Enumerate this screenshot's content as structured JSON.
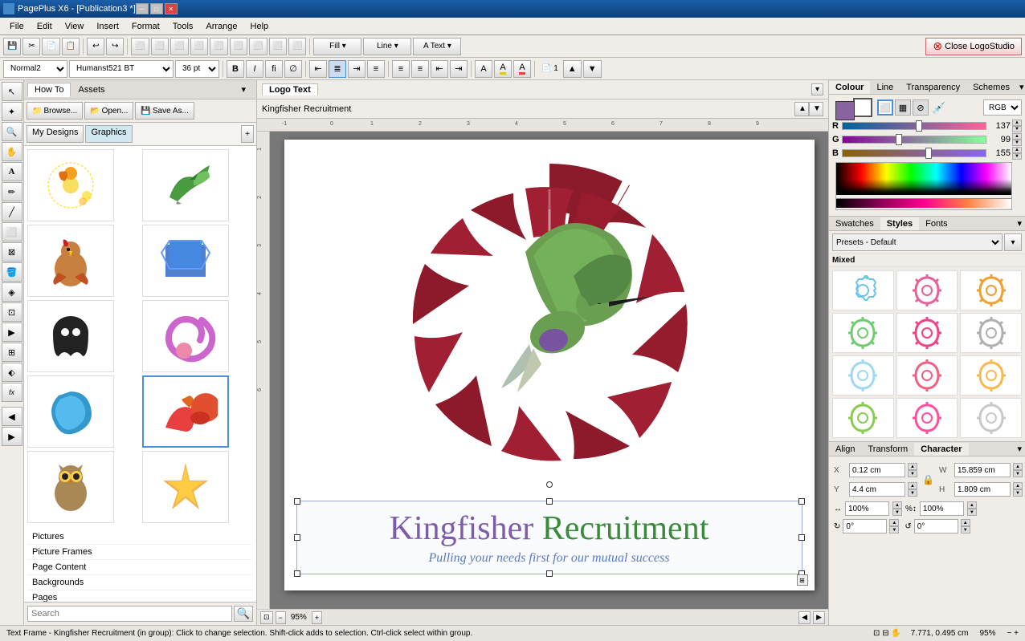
{
  "titleBar": {
    "title": "PagePlus X6 - [Publication3 *]",
    "minimize": "─",
    "maximize": "□",
    "close": "✕"
  },
  "menuBar": {
    "items": [
      "File",
      "Edit",
      "View",
      "Insert",
      "Format",
      "Tools",
      "Arrange",
      "Help"
    ]
  },
  "toolbar1": {
    "buttons": [
      "💾",
      "✂",
      "📋",
      "📋",
      "↩",
      "↪",
      "⬜",
      "⬜",
      "⬜",
      "⬜",
      "⬜",
      "⬜"
    ],
    "fillLabel": "Fill ▾",
    "lineLabel": "Line ▾",
    "textLabel": "A Text ▾",
    "closeLogoStudio": "Close LogoStudio"
  },
  "toolbar2": {
    "fontStyle": "Normal2",
    "fontName": "Humanst521 BT",
    "fontSize": "36 pt",
    "bold": "B",
    "italic": "I",
    "other": "fi",
    "other2": "∅",
    "alignLeft": "≡",
    "alignCenter": "≡",
    "alignRight": "≡",
    "justify": "≡",
    "listBullet": "≡",
    "listNum": "≡",
    "indent1": "⇤",
    "indent2": "⇥",
    "charBtn": "A",
    "highlightBtn": "A",
    "page": "1"
  },
  "assetsPanel": {
    "tabs": {
      "howTo": "How To",
      "assets": "Assets"
    },
    "buttons": {
      "browse": "Browse...",
      "open": "Open...",
      "saveAs": "Save As..."
    },
    "navItems": {
      "myDesigns": "My Designs",
      "graphics": "Graphics"
    },
    "searchPlaceholder": "Search",
    "categories": {
      "pictures": "Pictures",
      "pictureFrames": "Picture Frames",
      "pageContent": "Page Content",
      "backgrounds": "Backgrounds",
      "pages": "Pages"
    }
  },
  "logoTextBar": {
    "tab": "Logo Text",
    "content": "Kingfisher Recruitment"
  },
  "canvas": {
    "title": "Kingfisher Recruitment",
    "subtitle": "Pulling your needs first for our mutual success",
    "zoomLevel": "95%",
    "coords": "7.771, 0.495 cm"
  },
  "statusBar": {
    "text": "Text Frame - Kingfisher Recruitment (in group): Click to change selection. Shift-click adds to selection. Ctrl-click select within group.",
    "coords": "7.771, 0.495 cm",
    "zoom": "95%"
  },
  "colorPanel": {
    "tabs": [
      "Colour",
      "Line",
      "Transparency",
      "Schemes"
    ],
    "activeTab": "Colour",
    "mode": "RGB",
    "r": {
      "label": "R",
      "value": 137
    },
    "g": {
      "label": "G",
      "value": 99
    },
    "b": {
      "label": "B",
      "value": 155
    }
  },
  "swatchesPanel": {
    "tabs": [
      "Swatches",
      "Styles",
      "Fonts"
    ],
    "activeTab": "Styles",
    "presets": "Presets - Default",
    "mixed": "Mixed",
    "swatches": [
      {
        "color": "#6bc5e8",
        "type": "gear"
      },
      {
        "color": "#e8609a",
        "type": "gear"
      },
      {
        "color": "#f0a030",
        "type": "gear"
      },
      {
        "color": "#70cc70",
        "type": "gear"
      },
      {
        "color": "#ee4488",
        "type": "gear"
      },
      {
        "color": "#b0b0b0",
        "type": "gear"
      },
      {
        "color": "#a0d8f0",
        "type": "gear"
      },
      {
        "color": "#f06080",
        "type": "gear"
      },
      {
        "color": "#f8b850",
        "type": "gear"
      },
      {
        "color": "#88cc50",
        "type": "gear"
      },
      {
        "color": "#ff50a0",
        "type": "gear"
      },
      {
        "color": "#c8c8c8",
        "type": "gear"
      }
    ]
  },
  "atcPanel": {
    "tabs": [
      "Align",
      "Transform",
      "Character"
    ],
    "activeTab": "Character",
    "x": {
      "label": "X",
      "value": "0.12 cm"
    },
    "y": {
      "label": "Y",
      "value": "4.4 cm"
    },
    "w": {
      "label": "W",
      "value": "15.859 cm"
    },
    "h": {
      "label": "H",
      "value": "1.809 cm"
    },
    "scaleW": "100%",
    "scaleH": "100%",
    "rotation": "0°"
  }
}
